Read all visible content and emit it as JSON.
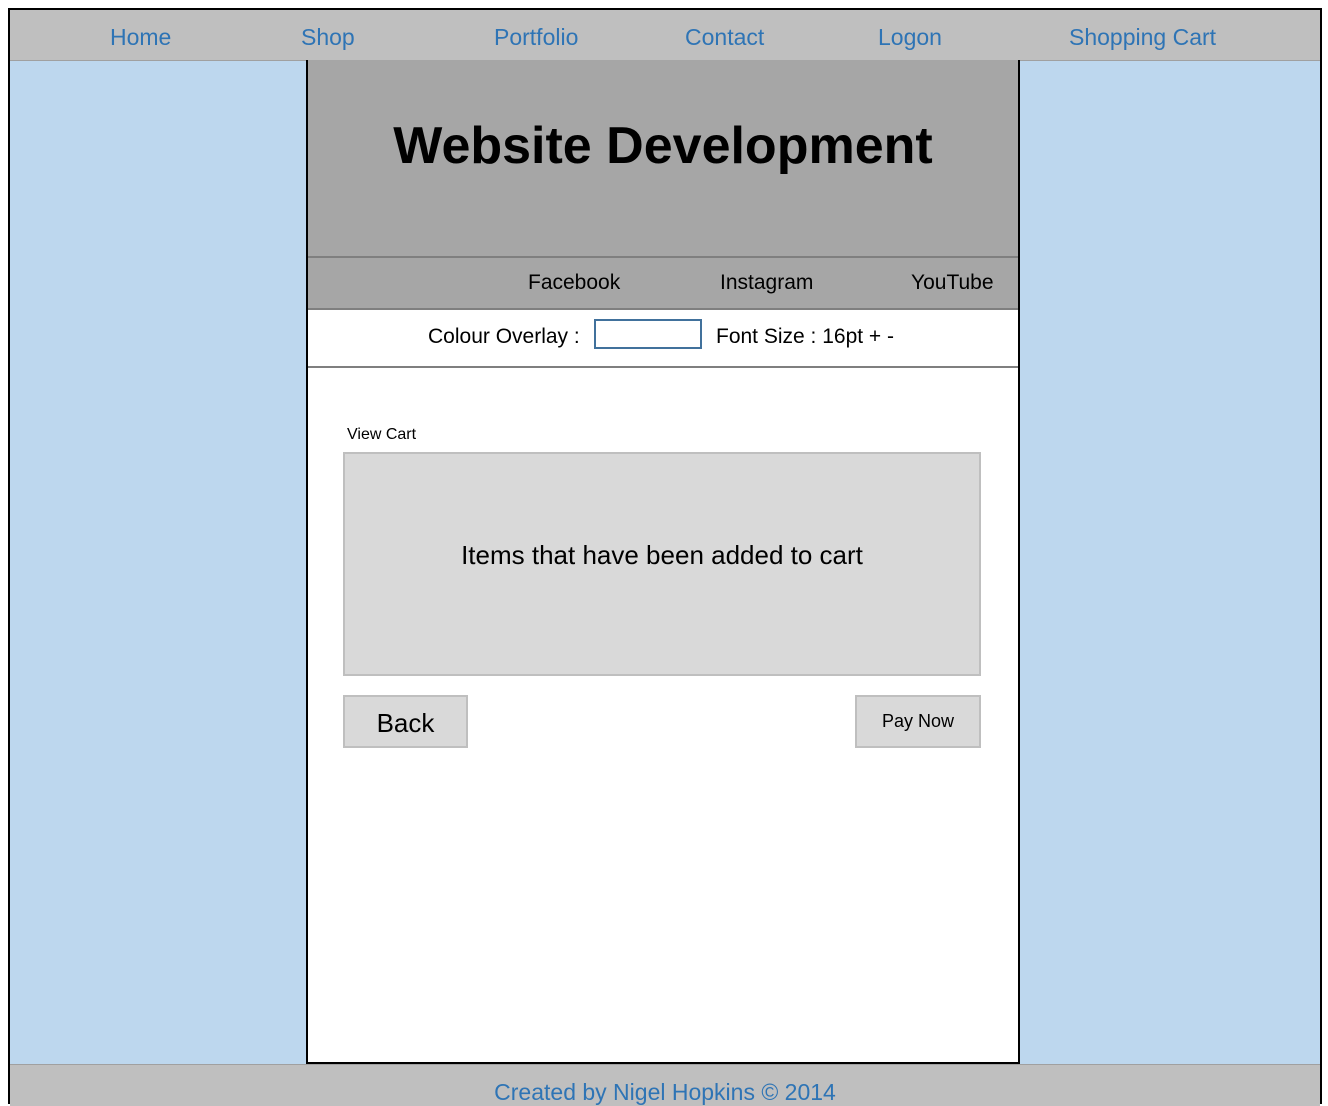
{
  "nav": {
    "items": [
      {
        "label": "Home"
      },
      {
        "label": "Shop"
      },
      {
        "label": "Portfolio"
      },
      {
        "label": "Contact"
      },
      {
        "label": "Logon"
      },
      {
        "label": "Shopping Cart"
      }
    ]
  },
  "banner": {
    "title": "Website Development"
  },
  "social": {
    "facebook": "Facebook",
    "instagram": "Instagram",
    "youtube": "YouTube"
  },
  "accessibility": {
    "colour_overlay_label": "Colour Overlay :",
    "colour_overlay_value": "",
    "font_size_label": "Font Size : 16pt + -"
  },
  "cart": {
    "heading": "View Cart",
    "placeholder_text": "Items that have been added to cart",
    "back_label": "Back",
    "pay_label": "Pay Now"
  },
  "footer": {
    "text": "Created by Nigel Hopkins © 2014"
  },
  "colors": {
    "link_blue": "#2e74b5",
    "side_background": "#bdd7ee",
    "bar_gray": "#bfbfbf",
    "banner_gray": "#a6a6a6",
    "box_gray": "#d9d9d9"
  }
}
